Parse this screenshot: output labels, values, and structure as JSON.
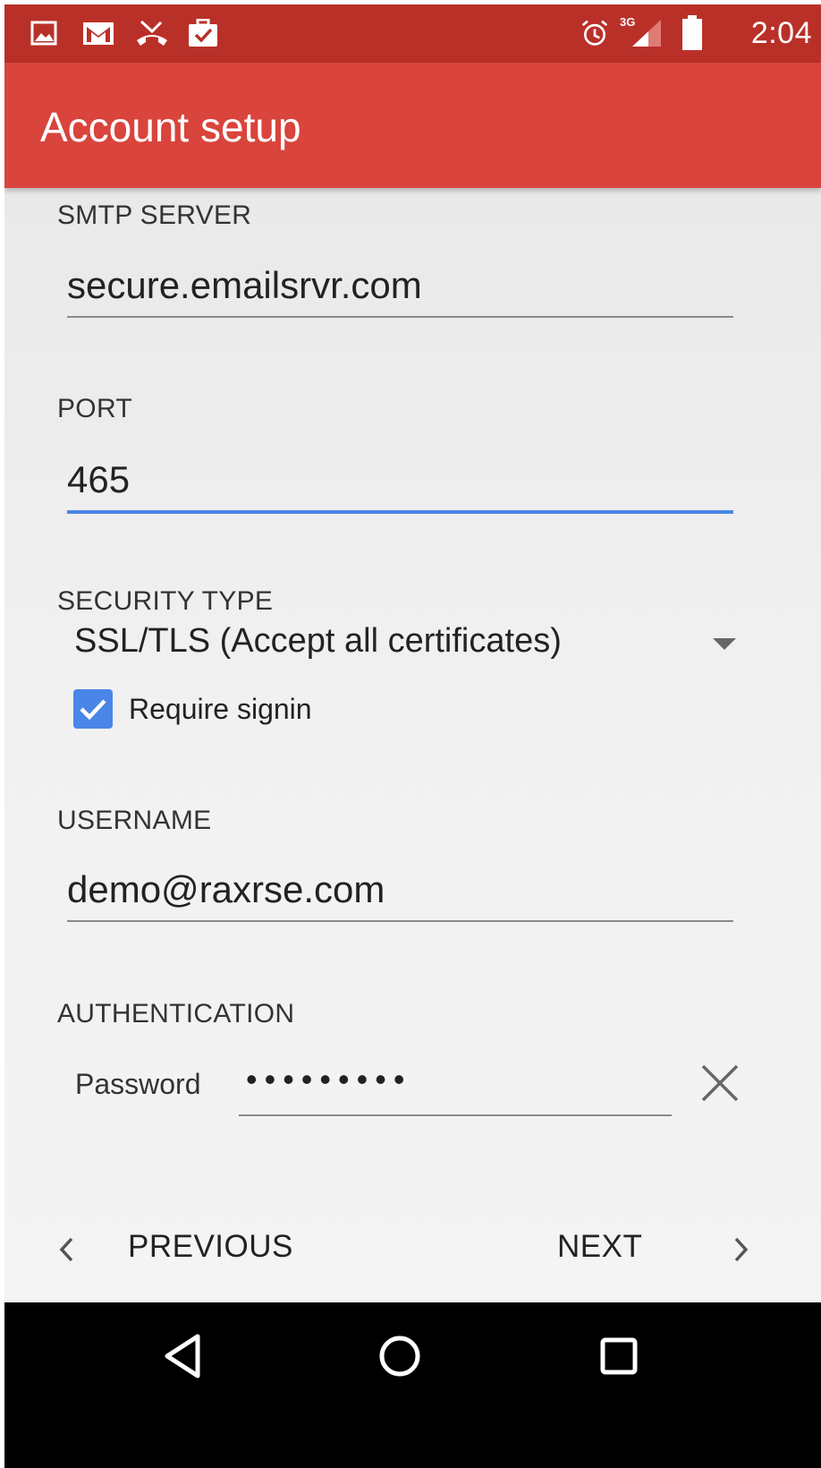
{
  "status_bar": {
    "time": "2:04",
    "network": "3G",
    "icons": [
      "image-icon",
      "gmail-icon",
      "missed-call-icon",
      "briefcase-check-icon",
      "alarm-icon",
      "signal-icon",
      "battery-icon"
    ]
  },
  "toolbar": {
    "title": "Account setup"
  },
  "form": {
    "smtp_server": {
      "label": "SMTP SERVER",
      "value": "secure.emailsrvr.com"
    },
    "port": {
      "label": "PORT",
      "value": "465"
    },
    "security_type": {
      "label": "SECURITY TYPE",
      "selected": "SSL/TLS (Accept all certificates)"
    },
    "require_signin": {
      "label": "Require signin",
      "checked": true
    },
    "username": {
      "label": "USERNAME",
      "value": "demo@raxrse.com"
    },
    "authentication": {
      "label": "AUTHENTICATION",
      "password_label": "Password",
      "password_value": "•••••••••"
    }
  },
  "navigation": {
    "previous_label": "PREVIOUS",
    "next_label": "NEXT"
  },
  "colors": {
    "toolbar": "#d9443c",
    "status_bar": "#b93028",
    "accent": "#4a86e8"
  }
}
